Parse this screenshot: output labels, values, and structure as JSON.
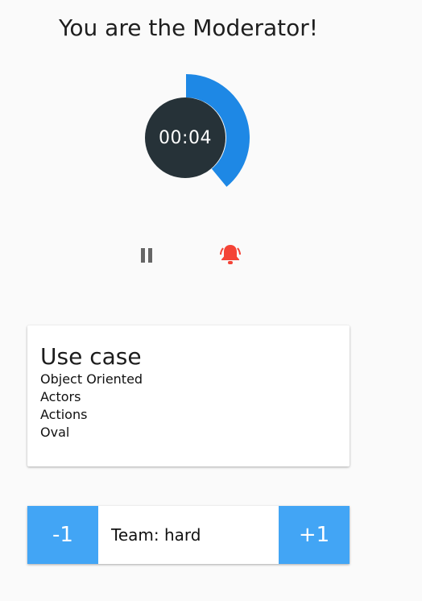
{
  "header": {
    "title": "You are the Moderator!"
  },
  "timer": {
    "display": "00:04",
    "progress_fraction": 0.39,
    "colors": {
      "ring": "#1e88e5",
      "center": "#263238"
    }
  },
  "controls": {
    "pause_icon": "pause-icon",
    "alarm_icon": "bell-icon",
    "alarm_color": "#f44336"
  },
  "card": {
    "title": "Use case",
    "items": [
      "Object Oriented",
      "Actors",
      "Actions",
      "Oval"
    ]
  },
  "scoreboard": {
    "minus_label": "-1",
    "team_label": "Team: hard",
    "plus_label": "+1",
    "button_color": "#42a5f5"
  }
}
